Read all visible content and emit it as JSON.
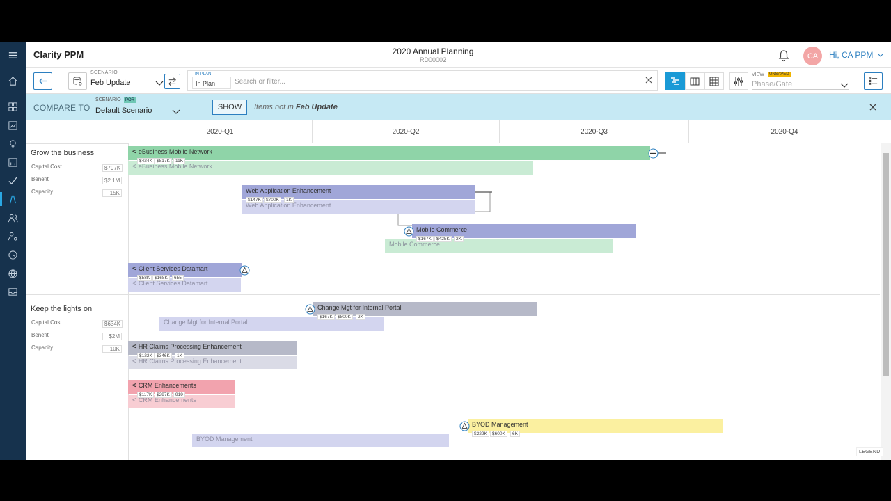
{
  "app": {
    "name": "Clarity PPM"
  },
  "page": {
    "title": "2020 Annual Planning",
    "code": "RD00002"
  },
  "user": {
    "initials": "CA",
    "greeting": "Hi, CA PPM"
  },
  "sidebar": {
    "icons": [
      "menu-icon",
      "home-icon",
      "dashboard-icon",
      "chart-line-icon",
      "lightbulb-icon",
      "bar-chart-icon",
      "check-icon",
      "roadmap-icon",
      "people-icon",
      "person-gear-icon",
      "clock-icon",
      "globe-icon",
      "inbox-icon"
    ],
    "active": "roadmap-icon"
  },
  "toolbar": {
    "scenario_label": "SCENARIO",
    "scenario_value": "Feb Update",
    "in_plan_label": "IN PLAN",
    "in_plan_value": "In Plan",
    "search_placeholder": "Search or filter...",
    "view_label": "VIEW",
    "unsaved_badge": "UNSAVED",
    "view_value": "Phase/Gate"
  },
  "compare": {
    "label": "COMPARE TO",
    "scenario_label": "SCENARIO",
    "por_badge": "POR",
    "scenario_value": "Default Scenario",
    "show_button": "SHOW",
    "note_prefix": "Items not in",
    "note_scenario": "Feb Update"
  },
  "timeline": {
    "quarters": [
      "2020-Q1",
      "2020-Q2",
      "2020-Q3",
      "2020-Q4"
    ],
    "legend": "LEGEND"
  },
  "groups": [
    {
      "title": "Grow the business",
      "metrics": [
        {
          "label": "Capital Cost",
          "value": "$797K"
        },
        {
          "label": "Benefit",
          "value": "$2.1M"
        },
        {
          "label": "Capacity",
          "value": "15K"
        }
      ]
    },
    {
      "title": "Keep the lights on",
      "metrics": [
        {
          "label": "Capital Cost",
          "value": "$634K"
        },
        {
          "label": "Benefit",
          "value": "$2M"
        },
        {
          "label": "Capacity",
          "value": "10K"
        }
      ]
    }
  ],
  "bars": [
    {
      "name": "eBusiness Mobile Network",
      "chips": [
        "$424K",
        "$817K",
        "11K"
      ],
      "color": "#8fd4a8",
      "ghost_name": "eBusiness Mobile Network",
      "ghost_color": "#c9ebd4"
    },
    {
      "name": "Web Application Enhancement",
      "chips": [
        "$147K",
        "$700K",
        "1K"
      ],
      "color": "#a0a6d8",
      "ghost_name": "Web Application Enhancement",
      "ghost_color": "#d3d5ef"
    },
    {
      "name": "Mobile Commerce",
      "chips": [
        "$167K",
        "$425K",
        "2K"
      ],
      "color": "#a0a6d8",
      "ghost_name": "Mobile Commerce",
      "ghost_color": "#c9ebd4"
    },
    {
      "name": "Client Services Datamart",
      "chips": [
        "$58K",
        "$168K",
        "655"
      ],
      "color": "#a0a6d8",
      "ghost_name": "Client Services Datamart",
      "ghost_color": "#d3d5ef"
    },
    {
      "name": "Change Mgt for Internal Portal",
      "chips": [
        "$167K",
        "$800K",
        "2K"
      ],
      "color": "#b6b9c8",
      "ghost_name": "Change Mgt for Internal Portal",
      "ghost_color": "#d3d5ef"
    },
    {
      "name": "HR Claims Processing Enhancement",
      "chips": [
        "$122K",
        "$346K",
        "1K"
      ],
      "color": "#b6b9c8",
      "ghost_name": "HR Claims Processing Enhancement",
      "ghost_color": "#dadbe6"
    },
    {
      "name": "CRM Enhancements",
      "chips": [
        "$117K",
        "$297K",
        "919"
      ],
      "color": "#f2a3ae",
      "ghost_name": "CRM Enhancements",
      "ghost_color": "#f8cdd3"
    },
    {
      "name": "BYOD Management",
      "chips": [
        "$229K",
        "$600K",
        "6K"
      ],
      "color": "#fbf0a0",
      "ghost_name": "BYOD Management",
      "ghost_color": "#d3d5ef"
    }
  ]
}
